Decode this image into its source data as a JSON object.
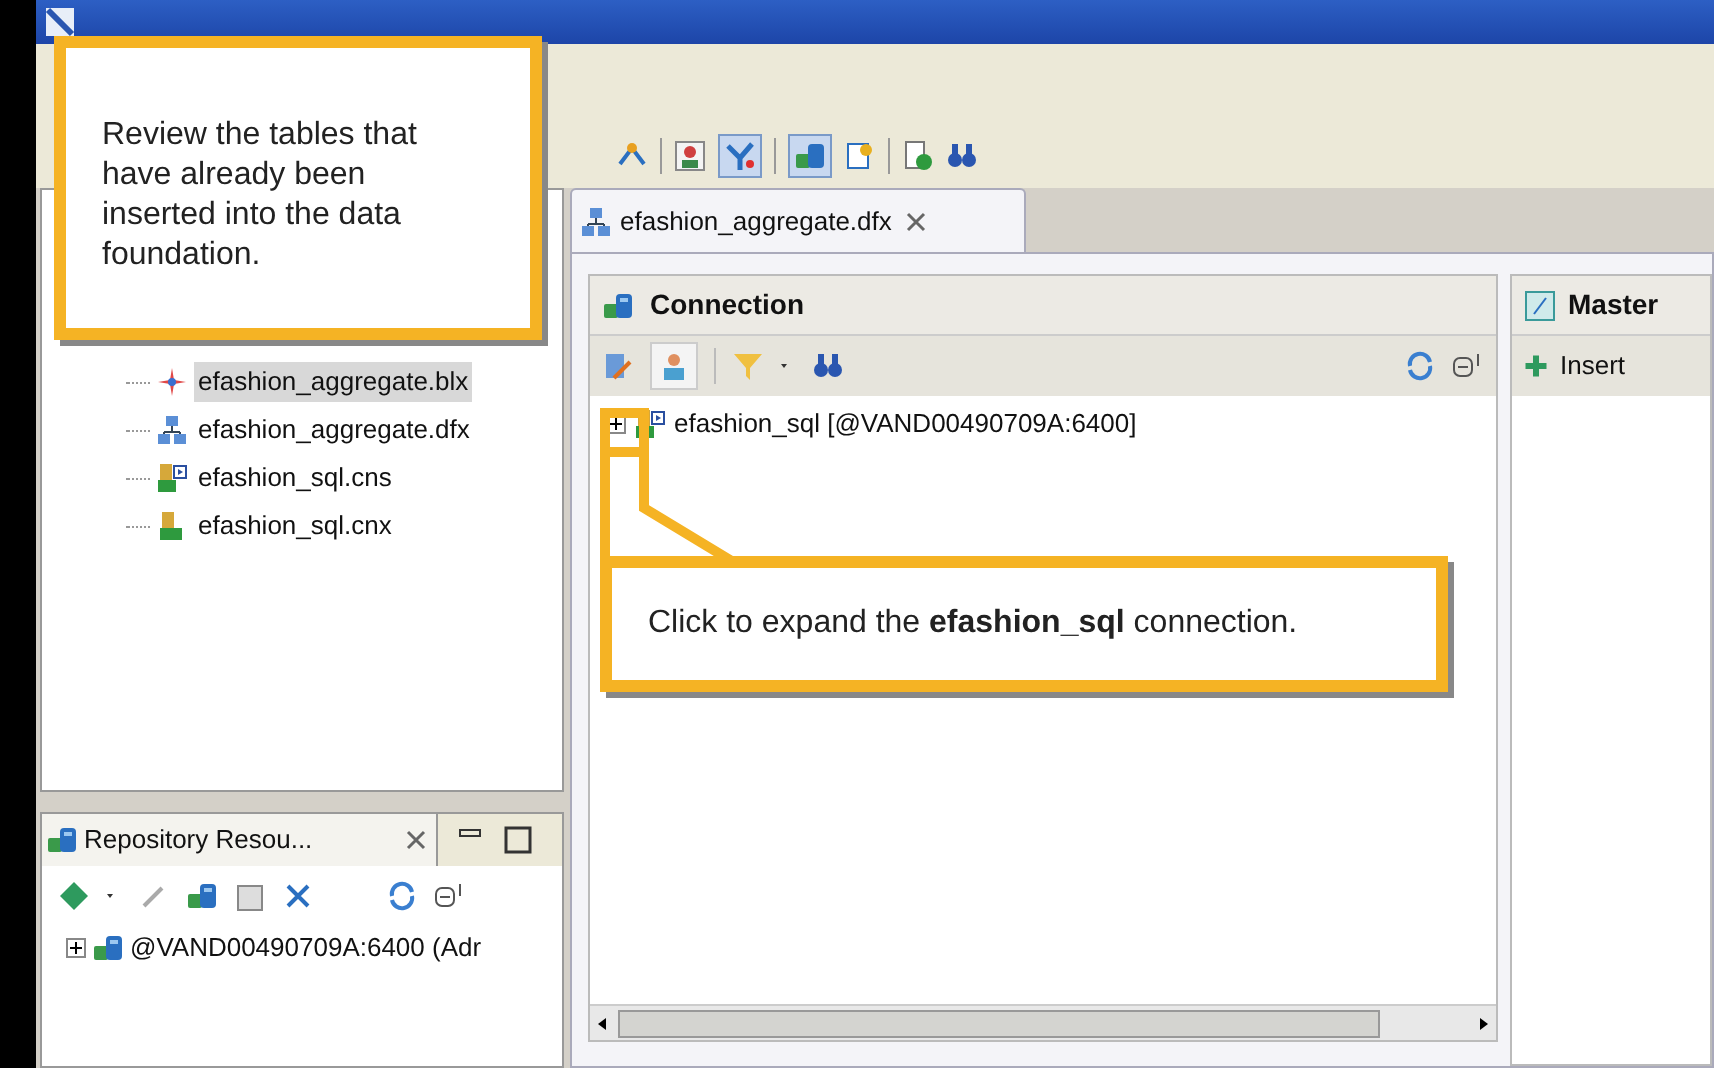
{
  "callouts": [
    {
      "text": "Review the tables that have already been inserted into the data foundation."
    },
    {
      "text": "Click to expand the **efashion_sql** connection."
    }
  ],
  "project_tree": {
    "items": [
      {
        "label": "efashion_aggregate.blx",
        "selected": true,
        "kind": "business-layer"
      },
      {
        "label": "efashion_aggregate.dfx",
        "selected": false,
        "kind": "data-foundation"
      },
      {
        "label": "efashion_sql.cns",
        "selected": false,
        "kind": "connection-shortcut"
      },
      {
        "label": "efashion_sql.cnx",
        "selected": false,
        "kind": "connection"
      }
    ]
  },
  "repository_panel": {
    "title": "Repository Resou...",
    "items": [
      {
        "label": "@VAND00490709A:6400 (Adr",
        "expanded": false
      }
    ]
  },
  "editor": {
    "tab": {
      "label": "efashion_aggregate.dfx"
    },
    "connection_pane": {
      "title": "Connection",
      "items": [
        {
          "label": "efashion_sql [@VAND00490709A:6400]",
          "expanded": false
        }
      ]
    },
    "master_pane": {
      "title": "Master",
      "insert_button": "Insert"
    }
  }
}
